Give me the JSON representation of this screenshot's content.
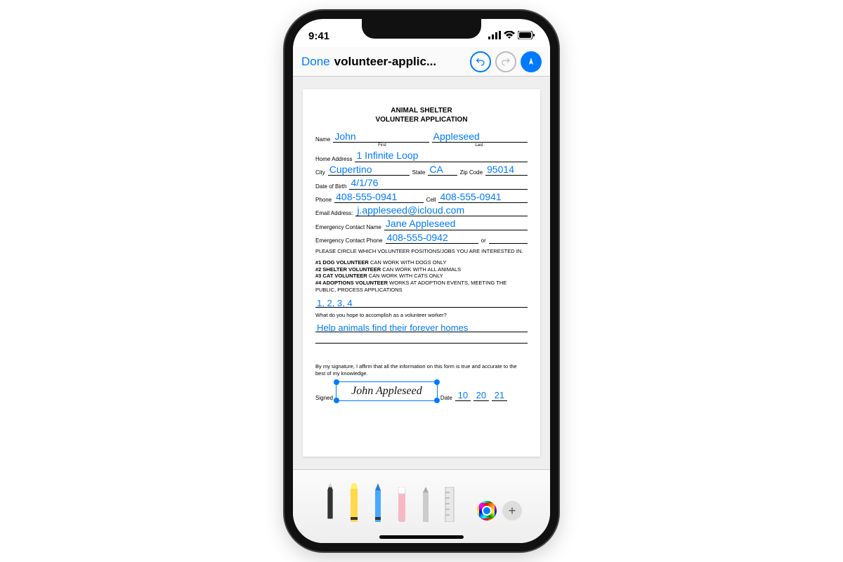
{
  "status": {
    "time": "9:41"
  },
  "nav": {
    "done": "Done",
    "title": "volunteer-applic..."
  },
  "doc": {
    "header1": "ANIMAL SHELTER",
    "header2": "VOLUNTEER APPLICATION",
    "labels": {
      "name": "Name",
      "first": "First",
      "last": "Last",
      "homeAddress": "Home Address",
      "city": "City",
      "state": "State",
      "zip": "Zip Code",
      "dob": "Date of Birth",
      "phone": "Phone",
      "cell": "Cell",
      "email": "Email Address:",
      "emName": "Emergency Contact Name",
      "emPhone": "Emergency Contact Phone",
      "or": "or",
      "signed": "Signed",
      "date": "Date"
    },
    "fields": {
      "first": "John",
      "last": "Appleseed",
      "address": "1 Infinite Loop",
      "city": "Cupertino",
      "state": "CA",
      "zip": "95014",
      "dob": "4/1/76",
      "phone": "408-555-0941",
      "cell": "408-555-0941",
      "email": "j.appleseed@icloud.com",
      "emName": "Jane Appleseed",
      "emPhone": "408-555-0942",
      "positions": "1, 2, 3, 4",
      "goal": "Help animals find their forever homes",
      "sigName": "John Appleseed",
      "dateM": "10",
      "dateD": "20",
      "dateY": "21"
    },
    "instructions": "PLEASE CIRCLE WHICH VOLUNTEER POSITIONS/JOBS YOU ARE INTERESTED IN.",
    "roles": {
      "r1b": "#1 DOG VOLUNTEER",
      "r1": " CAN WORK WITH DOGS ONLY",
      "r2b": "#2 SHELTER VOLUNTEER",
      "r2": " CAN WORK WITH ALL ANIMALS",
      "r3b": "#3 CAT VOLUNTEER",
      "r3": " CAN WORK WITH CATS ONLY",
      "r4b": "#4 ADOPTIONS VOLUNTEER",
      "r4": " WORKS AT ADOPTION EVENTS, MEETING THE PUBLIC, PROCESS APPLICATIONS"
    },
    "question": "What do you hope to accomplish as a volunteer worker?",
    "affirm": "By my signature, I affirm that all the information on this form is true and accurate to the best of my knowledge."
  }
}
